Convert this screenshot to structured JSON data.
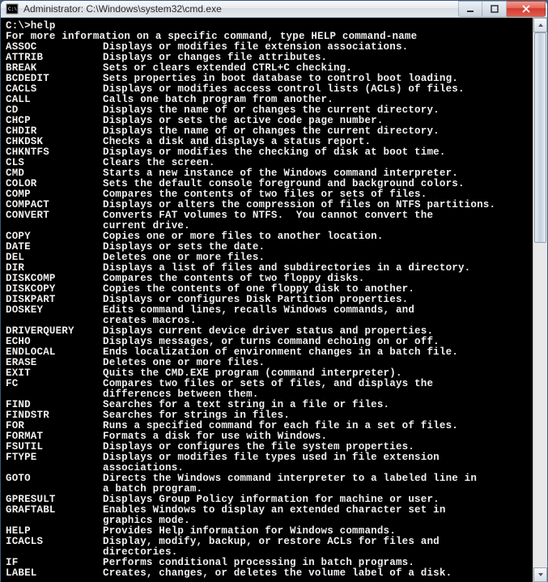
{
  "window": {
    "title": "Administrator: C:\\Windows\\system32\\cmd.exe"
  },
  "prompt": "C:\\>help",
  "intro": "For more information on a specific command, type HELP command-name",
  "commands": [
    {
      "name": "ASSOC",
      "desc": "Displays or modifies file extension associations."
    },
    {
      "name": "ATTRIB",
      "desc": "Displays or changes file attributes."
    },
    {
      "name": "BREAK",
      "desc": "Sets or clears extended CTRL+C checking."
    },
    {
      "name": "BCDEDIT",
      "desc": "Sets properties in boot database to control boot loading."
    },
    {
      "name": "CACLS",
      "desc": "Displays or modifies access control lists (ACLs) of files."
    },
    {
      "name": "CALL",
      "desc": "Calls one batch program from another."
    },
    {
      "name": "CD",
      "desc": "Displays the name of or changes the current directory."
    },
    {
      "name": "CHCP",
      "desc": "Displays or sets the active code page number."
    },
    {
      "name": "CHDIR",
      "desc": "Displays the name of or changes the current directory."
    },
    {
      "name": "CHKDSK",
      "desc": "Checks a disk and displays a status report."
    },
    {
      "name": "CHKNTFS",
      "desc": "Displays or modifies the checking of disk at boot time."
    },
    {
      "name": "CLS",
      "desc": "Clears the screen."
    },
    {
      "name": "CMD",
      "desc": "Starts a new instance of the Windows command interpreter."
    },
    {
      "name": "COLOR",
      "desc": "Sets the default console foreground and background colors."
    },
    {
      "name": "COMP",
      "desc": "Compares the contents of two files or sets of files."
    },
    {
      "name": "COMPACT",
      "desc": "Displays or alters the compression of files on NTFS partitions."
    },
    {
      "name": "CONVERT",
      "desc": "Converts FAT volumes to NTFS.  You cannot convert the",
      "cont": "current drive."
    },
    {
      "name": "COPY",
      "desc": "Copies one or more files to another location."
    },
    {
      "name": "DATE",
      "desc": "Displays or sets the date."
    },
    {
      "name": "DEL",
      "desc": "Deletes one or more files."
    },
    {
      "name": "DIR",
      "desc": "Displays a list of files and subdirectories in a directory."
    },
    {
      "name": "DISKCOMP",
      "desc": "Compares the contents of two floppy disks."
    },
    {
      "name": "DISKCOPY",
      "desc": "Copies the contents of one floppy disk to another."
    },
    {
      "name": "DISKPART",
      "desc": "Displays or configures Disk Partition properties."
    },
    {
      "name": "DOSKEY",
      "desc": "Edits command lines, recalls Windows commands, and",
      "cont": "creates macros."
    },
    {
      "name": "DRIVERQUERY",
      "desc": "Displays current device driver status and properties."
    },
    {
      "name": "ECHO",
      "desc": "Displays messages, or turns command echoing on or off."
    },
    {
      "name": "ENDLOCAL",
      "desc": "Ends localization of environment changes in a batch file."
    },
    {
      "name": "ERASE",
      "desc": "Deletes one or more files."
    },
    {
      "name": "EXIT",
      "desc": "Quits the CMD.EXE program (command interpreter)."
    },
    {
      "name": "FC",
      "desc": "Compares two files or sets of files, and displays the",
      "cont": "differences between them."
    },
    {
      "name": "FIND",
      "desc": "Searches for a text string in a file or files."
    },
    {
      "name": "FINDSTR",
      "desc": "Searches for strings in files."
    },
    {
      "name": "FOR",
      "desc": "Runs a specified command for each file in a set of files."
    },
    {
      "name": "FORMAT",
      "desc": "Formats a disk for use with Windows."
    },
    {
      "name": "FSUTIL",
      "desc": "Displays or configures the file system properties."
    },
    {
      "name": "FTYPE",
      "desc": "Displays or modifies file types used in file extension",
      "cont": "associations."
    },
    {
      "name": "GOTO",
      "desc": "Directs the Windows command interpreter to a labeled line in",
      "cont": "a batch program."
    },
    {
      "name": "GPRESULT",
      "desc": "Displays Group Policy information for machine or user."
    },
    {
      "name": "GRAFTABL",
      "desc": "Enables Windows to display an extended character set in",
      "cont": "graphics mode."
    },
    {
      "name": "HELP",
      "desc": "Provides Help information for Windows commands."
    },
    {
      "name": "ICACLS",
      "desc": "Display, modify, backup, or restore ACLs for files and",
      "cont": "directories."
    },
    {
      "name": "IF",
      "desc": "Performs conditional processing in batch programs."
    },
    {
      "name": "LABEL",
      "desc": "Creates, changes, or deletes the volume label of a disk."
    }
  ]
}
